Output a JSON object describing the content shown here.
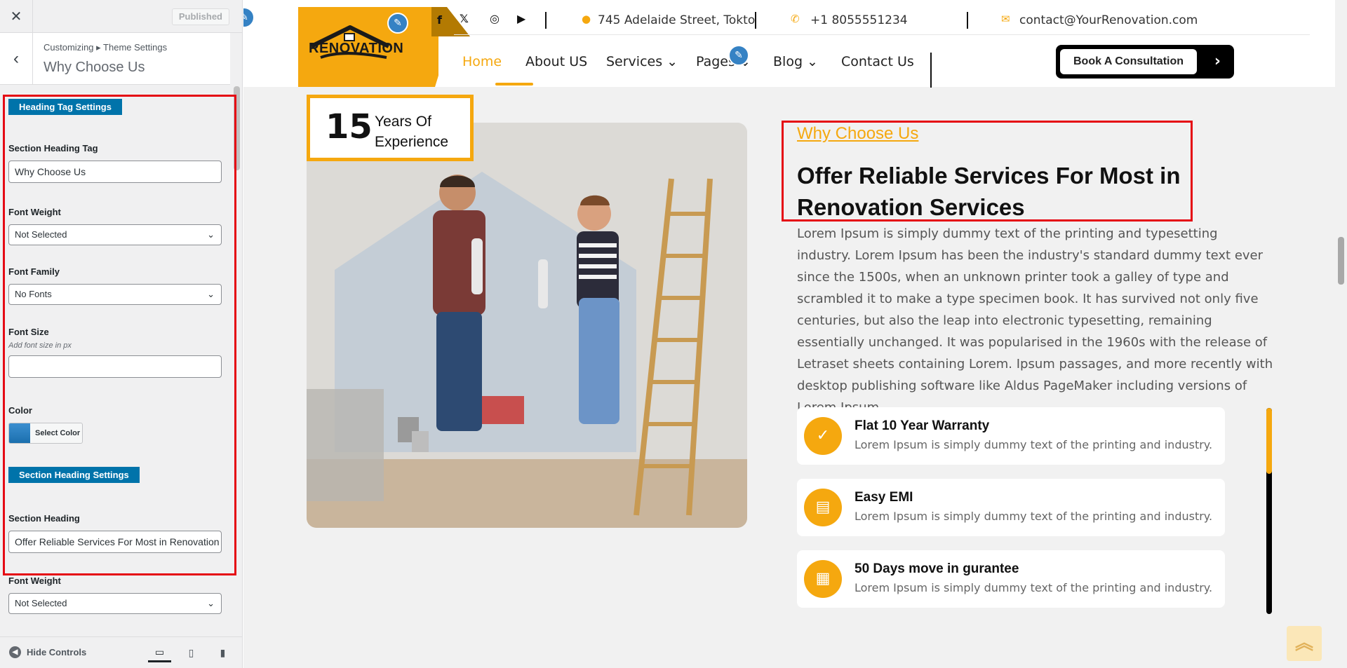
{
  "customizer": {
    "close_label": "✕",
    "status_button": "Published",
    "back_label": "‹",
    "breadcrumb": "Customizing ▸ Theme Settings",
    "section_title": "Why Choose Us",
    "heading_tag_settings_label": "Heading Tag Settings",
    "section_heading_tag": {
      "label": "Section Heading Tag",
      "value": "Why Choose Us"
    },
    "font_weight_1": {
      "label": "Font Weight",
      "value": "Not Selected"
    },
    "font_family": {
      "label": "Font Family",
      "value": "No Fonts"
    },
    "font_size": {
      "label": "Font Size",
      "hint": "Add font size in px",
      "value": ""
    },
    "color": {
      "label": "Color",
      "button": "Select Color"
    },
    "section_heading_settings_label": "Section Heading Settings",
    "section_heading": {
      "label": "Section Heading",
      "value": "Offer Reliable Services For Most in Renovation Services"
    },
    "font_weight_2": {
      "label": "Font Weight",
      "value": "Not Selected"
    },
    "hide_controls": "Hide Controls"
  },
  "site": {
    "logo_text": "RÉNOVATION",
    "address": "745 Adelaide Street, Tokto",
    "phone": "+1 8055551234",
    "email": "contact@YourRenovation.com",
    "nav": {
      "home": "Home",
      "about": "About US",
      "services": "Services",
      "pages": "Pages",
      "blog": "Blog",
      "contact": "Contact Us"
    },
    "book_button": "Book A Consultation",
    "years_number": "15",
    "years_line1": "Years Of",
    "years_line2": "Experience",
    "section_tag": "Why Choose Us",
    "section_heading": "Offer Reliable Services For Most in Renovation Services",
    "body_text": "Lorem Ipsum is simply dummy text of the printing and typesetting industry. Lorem Ipsum has been the industry's standard dummy text ever since the 1500s, when an unknown printer took a galley of type and scrambled it to make a type specimen book. It has survived not only five centuries, but also the leap into electronic typesetting, remaining essentially unchanged. It was popularised in the 1960s with the release of Letraset sheets containing Lorem. Ipsum passages, and more recently with desktop publishing software like Aldus PageMaker including versions of Lorem Ipsum.",
    "features": [
      {
        "title": "Flat 10 Year Warranty",
        "desc": "Lorem Ipsum is simply dummy text of the printing and industry.",
        "icon": "badge-check-icon"
      },
      {
        "title": "Easy EMI",
        "desc": "Lorem Ipsum is simply dummy text of the printing and industry.",
        "icon": "document-icon"
      },
      {
        "title": "50 Days move in gurantee",
        "desc": "Lorem Ipsum is simply dummy text of the printing and industry.",
        "icon": "building-icon"
      }
    ],
    "features_scroll_progress": 0.32
  },
  "colors": {
    "accent": "#f5a80f",
    "accent_dark": "#b37a02",
    "wp_blue": "#0073aa",
    "highlight_red": "#e50914"
  }
}
